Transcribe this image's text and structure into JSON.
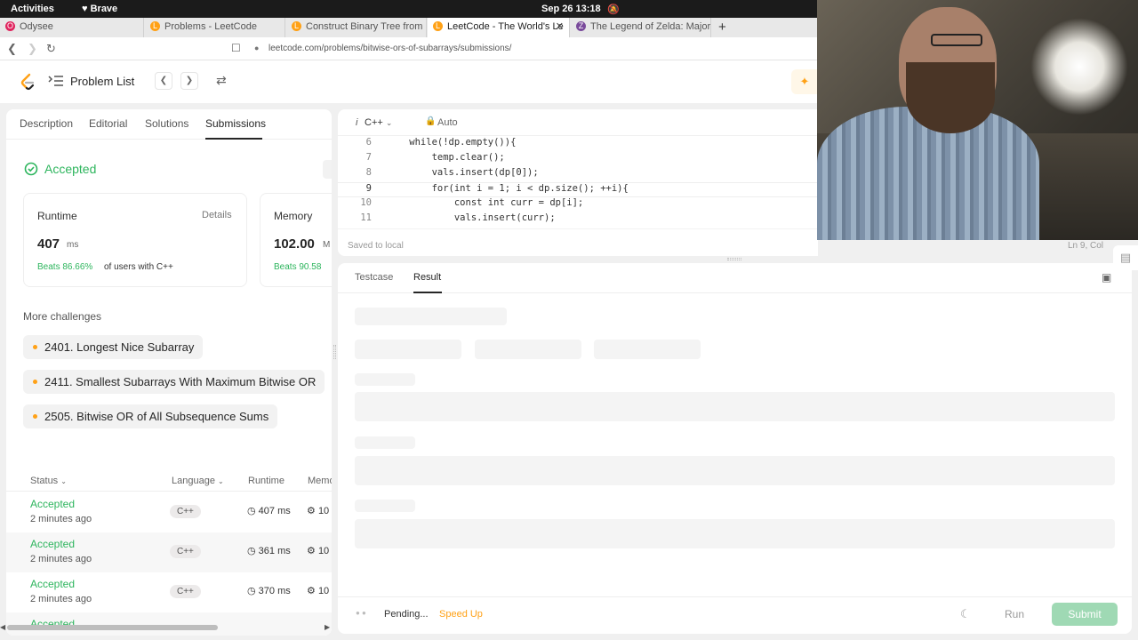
{
  "topbar": {
    "activities": "Activities",
    "browser": "Brave",
    "clock": "Sep 26  13:18"
  },
  "tabs": [
    {
      "label": "Odysee",
      "color": "#e0245e",
      "glyph": "O"
    },
    {
      "label": "Problems - LeetCode",
      "color": "#ffa116",
      "glyph": "L"
    },
    {
      "label": "Construct Binary Tree from Pr",
      "color": "#ffa116",
      "glyph": "L"
    },
    {
      "label": "LeetCode - The World's Le",
      "color": "#ffa116",
      "glyph": "L"
    },
    {
      "label": "The Legend of Zelda: Majora's",
      "color": "#7a4b9b",
      "glyph": "Z"
    }
  ],
  "address": {
    "url": "leetcode.com/problems/bitwise-ors-of-subarrays/submissions/"
  },
  "header": {
    "problem_list": "Problem List"
  },
  "left_tabs": [
    "Description",
    "Editorial",
    "Solutions",
    "Submissions"
  ],
  "result": {
    "status": "Accepted",
    "runtime_label": "Runtime",
    "details": "Details",
    "runtime_value": "407",
    "runtime_unit": "ms",
    "runtime_beats": "Beats 86.66%",
    "runtime_suffix": "of users with C++",
    "memory_label": "Memory",
    "memory_value": "102.00",
    "memory_unit": "M",
    "memory_beats": "Beats 90.58"
  },
  "more_challenges": {
    "title": "More challenges",
    "items": [
      "2401. Longest Nice Subarray",
      "2411. Smallest Subarrays With Maximum Bitwise OR",
      "2505. Bitwise OR of All Subsequence Sums"
    ]
  },
  "submissions": {
    "headers": {
      "status": "Status",
      "language": "Language",
      "runtime": "Runtime",
      "memory": "Memo"
    },
    "rows": [
      {
        "status": "Accepted",
        "time": "2 minutes ago",
        "lang": "C++",
        "runtime": "407 ms",
        "memory": "10"
      },
      {
        "status": "Accepted",
        "time": "2 minutes ago",
        "lang": "C++",
        "runtime": "361 ms",
        "memory": "10"
      },
      {
        "status": "Accepted",
        "time": "2 minutes ago",
        "lang": "C++",
        "runtime": "370 ms",
        "memory": "10"
      },
      {
        "status": "Accepted",
        "time": "",
        "lang": "",
        "runtime": "",
        "memory": ""
      }
    ]
  },
  "editor": {
    "language": "C++",
    "mode": "Auto",
    "saved": "Saved to local",
    "cursor": "Ln 9, Col",
    "lines": [
      {
        "num": "6",
        "code": "    while(!dp.empty()){"
      },
      {
        "num": "7",
        "code": "        temp.clear();"
      },
      {
        "num": "8",
        "code": "        vals.insert(dp[0]);"
      },
      {
        "num": "9",
        "code": "        for(int i = 1; i < dp.size(); ++i){"
      },
      {
        "num": "10",
        "code": "            const int curr = dp[i];"
      },
      {
        "num": "11",
        "code": "            vals.insert(curr);"
      }
    ]
  },
  "result_panel": {
    "tabs": [
      "Testcase",
      "Result"
    ]
  },
  "footer": {
    "pending": "Pending...",
    "speed_up": "Speed Up",
    "run": "Run",
    "submit": "Submit"
  },
  "colors": {
    "accepted": "#2db55d",
    "brand": "#ffa116",
    "submit": "#9fd9b4"
  }
}
